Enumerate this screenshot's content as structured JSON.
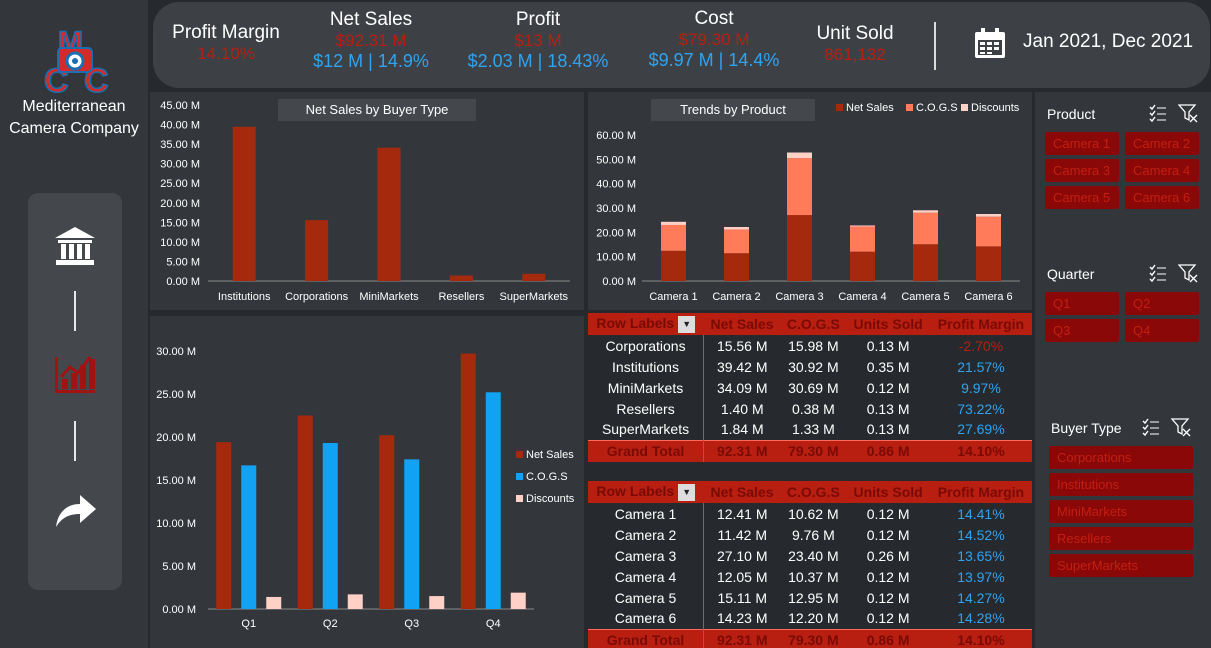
{
  "sidebar": {
    "company_line1": "Mediterranean",
    "company_line2": "Camera Company",
    "nav": [
      "bank-icon",
      "bar-chart-icon",
      "share-arrow-icon"
    ]
  },
  "kpis": {
    "profit_margin": {
      "label": "Profit Margin",
      "value": "14.10%"
    },
    "net_sales": {
      "label": "Net Sales",
      "value": "$92.31 M",
      "sub": "$12 M | 14.9%"
    },
    "profit": {
      "label": "Profit",
      "value": "$13 M",
      "sub": "$2.03 M | 18.43%"
    },
    "cost": {
      "label": "Cost",
      "value": "$79.30 M",
      "sub": "$9.97 M | 14.4%"
    },
    "units": {
      "label": "Unit Sold",
      "value": "861,132"
    },
    "date_range": "Jan 2021, Dec 2021"
  },
  "colors": {
    "net_sales": "#a52a0d",
    "cogs": "#ff7b5a",
    "discounts": "#ffd1c6",
    "cogs_blue": "#12a2f4",
    "accent_red": "#b81f10",
    "accent_blue": "#2fa3f0"
  },
  "chart_data": [
    {
      "type": "bar",
      "title": "Net Sales by Buyer Type",
      "categories": [
        "Institutions",
        "Corporations",
        "MiniMarkets",
        "Resellers",
        "SuperMarkets"
      ],
      "series": [
        {
          "name": "Net Sales",
          "values": [
            39.42,
            15.56,
            34.09,
            1.4,
            1.84
          ]
        }
      ],
      "ylim": [
        0,
        45
      ],
      "yticks": [
        "0.00 M",
        "5.00 M",
        "10.00 M",
        "15.00 M",
        "20.00 M",
        "25.00 M",
        "30.00 M",
        "35.00 M",
        "40.00 M",
        "45.00 M"
      ]
    },
    {
      "type": "bar",
      "stacked": true,
      "title": "Trends by Product",
      "categories": [
        "Camera 1",
        "Camera 2",
        "Camera 3",
        "Camera 4",
        "Camera 5",
        "Camera 6"
      ],
      "series": [
        {
          "name": "Net Sales",
          "values": [
            12.41,
            11.42,
            27.1,
            12.05,
            15.11,
            14.23
          ]
        },
        {
          "name": "C.O.G.S",
          "values": [
            10.62,
            9.76,
            23.4,
            10.37,
            12.95,
            12.2
          ]
        },
        {
          "name": "Discounts",
          "values": [
            1.3,
            1.0,
            2.3,
            0.4,
            1.0,
            1.1
          ]
        }
      ],
      "ylim": [
        0,
        60
      ],
      "yticks": [
        "0.00 M",
        "10.00 M",
        "20.00 M",
        "30.00 M",
        "40.00 M",
        "50.00 M",
        "60.00 M"
      ],
      "legend": "top-right"
    },
    {
      "type": "bar",
      "categories": [
        "Q1",
        "Q2",
        "Q3",
        "Q4"
      ],
      "series": [
        {
          "name": "Net Sales",
          "values": [
            19.4,
            22.5,
            20.2,
            29.7
          ]
        },
        {
          "name": "C.O.G.S",
          "values": [
            16.7,
            19.3,
            17.4,
            25.2
          ]
        },
        {
          "name": "Discounts",
          "values": [
            1.4,
            1.7,
            1.5,
            1.9
          ]
        }
      ],
      "ylim": [
        0,
        30
      ],
      "yticks": [
        "0.00 M",
        "5.00 M",
        "10.00 M",
        "15.00 M",
        "20.00 M",
        "25.00 M",
        "30.00 M"
      ],
      "legend": "right"
    }
  ],
  "pivot_buyer": {
    "headers": [
      "Row Labels",
      "Net Sales",
      "C.O.G.S",
      "Units Sold",
      "Profit Margin"
    ],
    "rows": [
      [
        "Corporations",
        "15.56 M",
        "15.98 M",
        "0.13 M",
        "-2.70%"
      ],
      [
        "Institutions",
        "39.42 M",
        "30.92 M",
        "0.35 M",
        "21.57%"
      ],
      [
        "MiniMarkets",
        "34.09 M",
        "30.69 M",
        "0.12 M",
        "9.97%"
      ],
      [
        "Resellers",
        "1.40 M",
        "0.38 M",
        "0.13 M",
        "73.22%"
      ],
      [
        "SuperMarkets",
        "1.84 M",
        "1.33 M",
        "0.13 M",
        "27.69%"
      ]
    ],
    "total": [
      "Grand Total",
      "92.31 M",
      "79.30 M",
      "0.86 M",
      "14.10%"
    ]
  },
  "pivot_product": {
    "headers": [
      "Row Labels",
      "Net Sales",
      "C.O.G.S",
      "Units Sold",
      "Profit Margin"
    ],
    "rows": [
      [
        "Camera 1",
        "12.41 M",
        "10.62 M",
        "0.12 M",
        "14.41%"
      ],
      [
        "Camera 2",
        "11.42 M",
        "9.76 M",
        "0.12 M",
        "14.52%"
      ],
      [
        "Camera 3",
        "27.10 M",
        "23.40 M",
        "0.26 M",
        "13.65%"
      ],
      [
        "Camera 4",
        "12.05 M",
        "10.37 M",
        "0.12 M",
        "13.97%"
      ],
      [
        "Camera 5",
        "15.11 M",
        "12.95 M",
        "0.12 M",
        "14.27%"
      ],
      [
        "Camera 6",
        "14.23 M",
        "12.20 M",
        "0.12 M",
        "14.28%"
      ]
    ],
    "total": [
      "Grand Total",
      "92.31 M",
      "79.30 M",
      "0.86 M",
      "14.10%"
    ]
  },
  "slicers": {
    "product": {
      "title": "Product",
      "items": [
        "Camera 1",
        "Camera 2",
        "Camera 3",
        "Camera 4",
        "Camera 5",
        "Camera 6"
      ]
    },
    "quarter": {
      "title": "Quarter",
      "items": [
        "Q1",
        "Q2",
        "Q3",
        "Q4"
      ]
    },
    "buyer": {
      "title": "Buyer Type",
      "items": [
        "Corporations",
        "Institutions",
        "MiniMarkets",
        "Resellers",
        "SuperMarkets"
      ]
    }
  }
}
